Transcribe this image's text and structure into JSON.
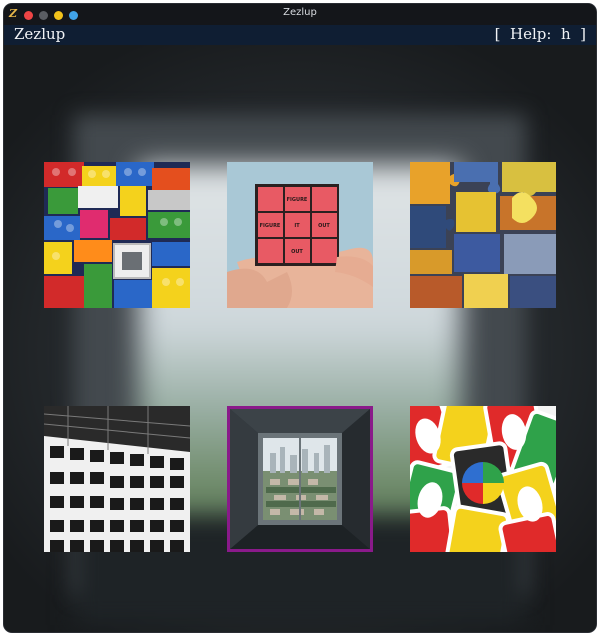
{
  "window": {
    "title": "Zezlup",
    "icon": "zezlup-app-icon"
  },
  "menubar": {
    "app_name": "Zezlup",
    "help_hint": "[  Help:  h  ]"
  },
  "colors": {
    "selection": "#8a1a8a",
    "menubar_bg": "#0f1e33",
    "close": "#ee4545",
    "minimize": "#f2c21b",
    "maximize": "#41a3e8"
  },
  "gallery": {
    "selected_index": 4,
    "tiles": [
      {
        "subject": "lego-bricks"
      },
      {
        "subject": "rubiks-cube-in-hand",
        "cube_words": [
          "FIGURE",
          "FIGURE",
          "IT",
          "OUT",
          "OUT"
        ]
      },
      {
        "subject": "jigsaw-puzzle-pieces"
      },
      {
        "subject": "building-facade"
      },
      {
        "subject": "window-city-view"
      },
      {
        "subject": "uno-cards"
      }
    ]
  }
}
